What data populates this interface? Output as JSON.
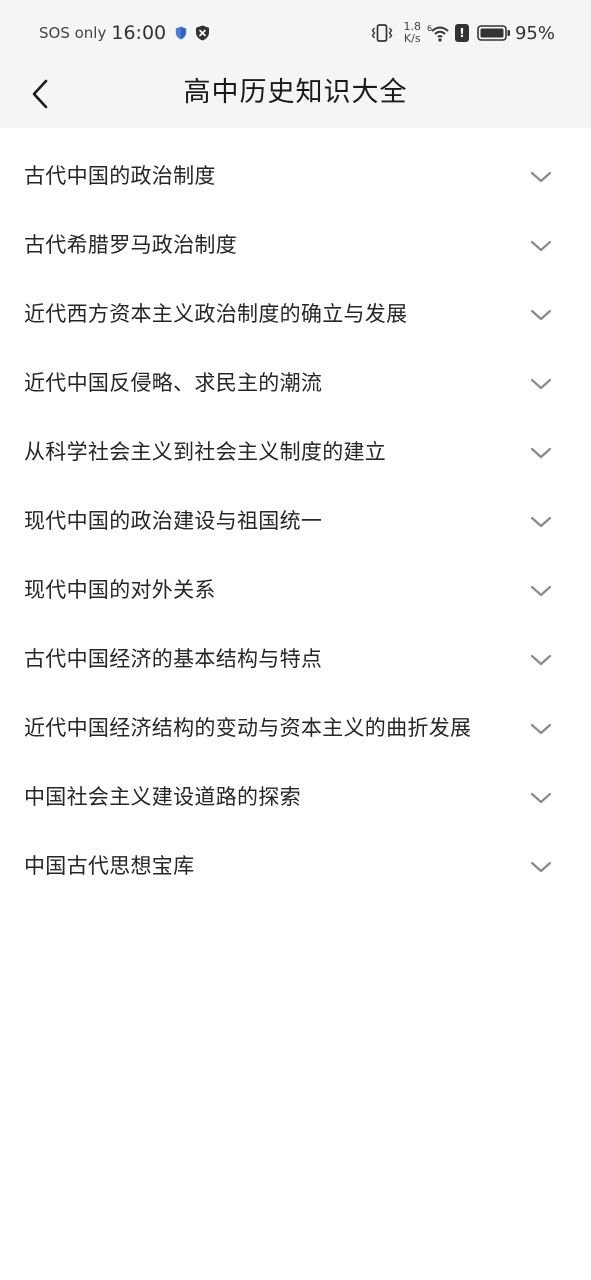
{
  "status_bar": {
    "carrier": "SOS only",
    "time": "16:00",
    "speed_value": "1.8",
    "speed_unit": "K/s",
    "battery": "95%",
    "wifi_tag": "6"
  },
  "header": {
    "title": "高中历史知识大全",
    "back_icon": "chevron-left-icon"
  },
  "topics": [
    {
      "label": "古代中国的政治制度"
    },
    {
      "label": "古代希腊罗马政治制度"
    },
    {
      "label": "近代西方资本主义政治制度的确立与发展"
    },
    {
      "label": "近代中国反侵略、求民主的潮流"
    },
    {
      "label": "从科学社会主义到社会主义制度的建立"
    },
    {
      "label": "现代中国的政治建设与祖国统一"
    },
    {
      "label": "现代中国的对外关系"
    },
    {
      "label": "古代中国经济的基本结构与特点"
    },
    {
      "label": "近代中国经济结构的变动与资本主义的曲折发展"
    },
    {
      "label": "中国社会主义建设道路的探索"
    },
    {
      "label": "中国古代思想宝库"
    }
  ],
  "colors": {
    "header_bg": "#f5f5f5",
    "text": "#262626",
    "chevron": "#8a8a8a",
    "shield": "#4a7bd8"
  }
}
